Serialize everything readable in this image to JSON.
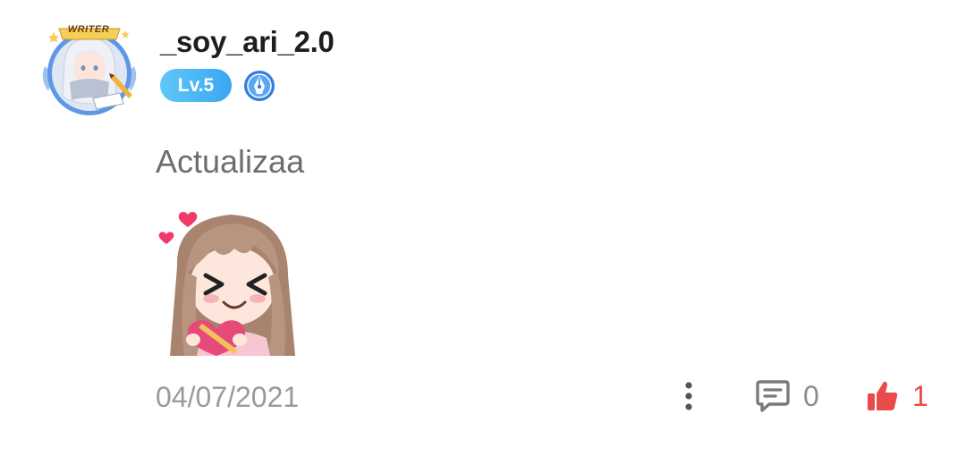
{
  "author": {
    "username": "_soy_ari_2.0",
    "level": "Lv.5",
    "avatar_frame_text": "WRITER",
    "avatar_icon": "anime-writer-avatar",
    "title_badge_icon": "blue-pen-nib-badge-icon"
  },
  "comment": {
    "text": "Actualizaa",
    "sticker_icon": "anime-girl-hearts-sticker"
  },
  "footer": {
    "date": "04/07/2021",
    "more_icon": "vertical-ellipsis-icon",
    "reply_icon": "comment-bubble-icon",
    "reply_count": "0",
    "like_icon": "thumbs-up-icon",
    "like_count": "1"
  },
  "colors": {
    "level_badge": "#3aa6f2",
    "like": "#e94b4b",
    "username": "#1e1e1e",
    "text": "#6d6d6d",
    "muted": "#9a9a9a"
  }
}
